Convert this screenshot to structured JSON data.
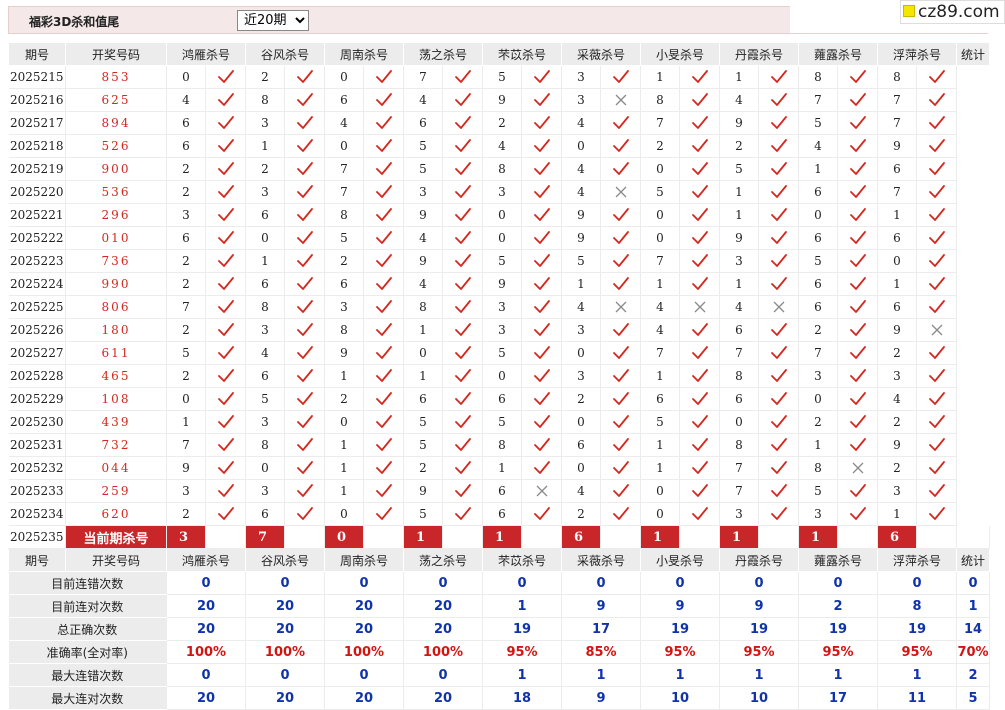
{
  "header": {
    "title": "福彩3D杀和值尾",
    "range_select": {
      "selected": "近20期",
      "options": [
        "近20期"
      ]
    },
    "logo_text": "cz89.com"
  },
  "columns": {
    "period": "期号",
    "code": "开奖号码",
    "experts": [
      "鸿雁杀号",
      "谷风杀号",
      "周南杀号",
      "荡之杀号",
      "芣苡杀号",
      "采薇杀号",
      "小旻杀号",
      "丹霞杀号",
      "蕹露杀号",
      "浮萍杀号"
    ],
    "stat": "统计"
  },
  "all_correct_label": "全对",
  "rows": [
    {
      "period": "2025215",
      "code": "853",
      "kills": [
        0,
        2,
        0,
        7,
        5,
        3,
        1,
        1,
        8,
        8
      ],
      "ok": [
        1,
        1,
        1,
        1,
        1,
        1,
        1,
        1,
        1,
        1
      ],
      "stat": "全对"
    },
    {
      "period": "2025216",
      "code": "625",
      "kills": [
        4,
        8,
        6,
        4,
        9,
        3,
        8,
        4,
        7,
        7
      ],
      "ok": [
        1,
        1,
        1,
        1,
        1,
        0,
        1,
        1,
        1,
        1
      ],
      "stat": "9"
    },
    {
      "period": "2025217",
      "code": "894",
      "kills": [
        6,
        3,
        4,
        6,
        2,
        4,
        7,
        9,
        5,
        7
      ],
      "ok": [
        1,
        1,
        1,
        1,
        1,
        1,
        1,
        1,
        1,
        1
      ],
      "stat": "全对"
    },
    {
      "period": "2025218",
      "code": "526",
      "kills": [
        6,
        1,
        0,
        5,
        4,
        0,
        2,
        2,
        4,
        9
      ],
      "ok": [
        1,
        1,
        1,
        1,
        1,
        1,
        1,
        1,
        1,
        1
      ],
      "stat": "全对"
    },
    {
      "period": "2025219",
      "code": "900",
      "kills": [
        2,
        2,
        7,
        5,
        8,
        4,
        0,
        5,
        1,
        6
      ],
      "ok": [
        1,
        1,
        1,
        1,
        1,
        1,
        1,
        1,
        1,
        1
      ],
      "stat": "全对"
    },
    {
      "period": "2025220",
      "code": "536",
      "kills": [
        2,
        3,
        7,
        3,
        3,
        4,
        5,
        1,
        6,
        7
      ],
      "ok": [
        1,
        1,
        1,
        1,
        1,
        0,
        1,
        1,
        1,
        1
      ],
      "stat": "9"
    },
    {
      "period": "2025221",
      "code": "296",
      "kills": [
        3,
        6,
        8,
        9,
        0,
        9,
        0,
        1,
        0,
        1
      ],
      "ok": [
        1,
        1,
        1,
        1,
        1,
        1,
        1,
        1,
        1,
        1
      ],
      "stat": "全对"
    },
    {
      "period": "2025222",
      "code": "010",
      "kills": [
        6,
        0,
        5,
        4,
        0,
        9,
        0,
        9,
        6,
        6
      ],
      "ok": [
        1,
        1,
        1,
        1,
        1,
        1,
        1,
        1,
        1,
        1
      ],
      "stat": "全对"
    },
    {
      "period": "2025223",
      "code": "736",
      "kills": [
        2,
        1,
        2,
        9,
        5,
        5,
        7,
        3,
        5,
        0
      ],
      "ok": [
        1,
        1,
        1,
        1,
        1,
        1,
        1,
        1,
        1,
        1
      ],
      "stat": "全对"
    },
    {
      "period": "2025224",
      "code": "990",
      "kills": [
        2,
        6,
        6,
        4,
        9,
        1,
        1,
        1,
        6,
        1
      ],
      "ok": [
        1,
        1,
        1,
        1,
        1,
        1,
        1,
        1,
        1,
        1
      ],
      "stat": "全对"
    },
    {
      "period": "2025225",
      "code": "806",
      "kills": [
        7,
        8,
        3,
        8,
        3,
        4,
        4,
        4,
        6,
        6
      ],
      "ok": [
        1,
        1,
        1,
        1,
        1,
        0,
        0,
        0,
        1,
        1
      ],
      "stat": "7"
    },
    {
      "period": "2025226",
      "code": "180",
      "kills": [
        2,
        3,
        8,
        1,
        3,
        3,
        4,
        6,
        2,
        9
      ],
      "ok": [
        1,
        1,
        1,
        1,
        1,
        1,
        1,
        1,
        1,
        0
      ],
      "stat": "9"
    },
    {
      "period": "2025227",
      "code": "611",
      "kills": [
        5,
        4,
        9,
        0,
        5,
        0,
        7,
        7,
        7,
        2
      ],
      "ok": [
        1,
        1,
        1,
        1,
        1,
        1,
        1,
        1,
        1,
        1
      ],
      "stat": "全对"
    },
    {
      "period": "2025228",
      "code": "465",
      "kills": [
        2,
        6,
        1,
        1,
        0,
        3,
        1,
        8,
        3,
        3
      ],
      "ok": [
        1,
        1,
        1,
        1,
        1,
        1,
        1,
        1,
        1,
        1
      ],
      "stat": "全对"
    },
    {
      "period": "2025229",
      "code": "108",
      "kills": [
        0,
        5,
        2,
        6,
        6,
        2,
        6,
        6,
        0,
        4
      ],
      "ok": [
        1,
        1,
        1,
        1,
        1,
        1,
        1,
        1,
        1,
        1
      ],
      "stat": "全对"
    },
    {
      "period": "2025230",
      "code": "439",
      "kills": [
        1,
        3,
        0,
        5,
        5,
        0,
        5,
        0,
        2,
        2
      ],
      "ok": [
        1,
        1,
        1,
        1,
        1,
        1,
        1,
        1,
        1,
        1
      ],
      "stat": "全对"
    },
    {
      "period": "2025231",
      "code": "732",
      "kills": [
        7,
        8,
        1,
        5,
        8,
        6,
        1,
        8,
        1,
        9
      ],
      "ok": [
        1,
        1,
        1,
        1,
        1,
        1,
        1,
        1,
        1,
        1
      ],
      "stat": "全对"
    },
    {
      "period": "2025232",
      "code": "044",
      "kills": [
        9,
        0,
        1,
        2,
        1,
        0,
        1,
        7,
        8,
        2
      ],
      "ok": [
        1,
        1,
        1,
        1,
        1,
        1,
        1,
        1,
        0,
        1
      ],
      "stat": "9"
    },
    {
      "period": "2025233",
      "code": "259",
      "kills": [
        3,
        3,
        1,
        9,
        6,
        4,
        0,
        7,
        5,
        3
      ],
      "ok": [
        1,
        1,
        1,
        1,
        0,
        1,
        1,
        1,
        1,
        1
      ],
      "stat": "9"
    },
    {
      "period": "2025234",
      "code": "620",
      "kills": [
        2,
        6,
        0,
        5,
        6,
        2,
        0,
        3,
        3,
        1
      ],
      "ok": [
        1,
        1,
        1,
        1,
        1,
        1,
        1,
        1,
        1,
        1
      ],
      "stat": "全对"
    }
  ],
  "current": {
    "period": "2025235",
    "label": "当前期杀号",
    "kills": [
      "3",
      "7",
      "0",
      "1",
      "1",
      "6",
      "1",
      "1",
      "1",
      "6"
    ]
  },
  "summary": {
    "rows": [
      {
        "label": "目前连错次数",
        "values": [
          "0",
          "0",
          "0",
          "0",
          "0",
          "0",
          "0",
          "0",
          "0",
          "0"
        ],
        "stat": "0",
        "red": false
      },
      {
        "label": "目前连对次数",
        "values": [
          "20",
          "20",
          "20",
          "20",
          "1",
          "9",
          "9",
          "9",
          "2",
          "8"
        ],
        "stat": "1",
        "red": false
      },
      {
        "label": "总正确次数",
        "values": [
          "20",
          "20",
          "20",
          "20",
          "19",
          "17",
          "19",
          "19",
          "19",
          "19"
        ],
        "stat": "14",
        "red": false
      },
      {
        "label": "准确率(全对率)",
        "values": [
          "100%",
          "100%",
          "100%",
          "100%",
          "95%",
          "85%",
          "95%",
          "95%",
          "95%",
          "95%"
        ],
        "stat": "70%",
        "red": true
      },
      {
        "label": "最大连错次数",
        "values": [
          "0",
          "0",
          "0",
          "0",
          "1",
          "1",
          "1",
          "1",
          "1",
          "1"
        ],
        "stat": "2",
        "red": false
      },
      {
        "label": "最大连对次数",
        "values": [
          "20",
          "20",
          "20",
          "20",
          "18",
          "9",
          "10",
          "10",
          "17",
          "11"
        ],
        "stat": "5",
        "red": false
      }
    ]
  },
  "colors": {
    "accent_red": "#cc2621",
    "stat_blue": "#1133aa",
    "header_gray": "#ececec"
  }
}
